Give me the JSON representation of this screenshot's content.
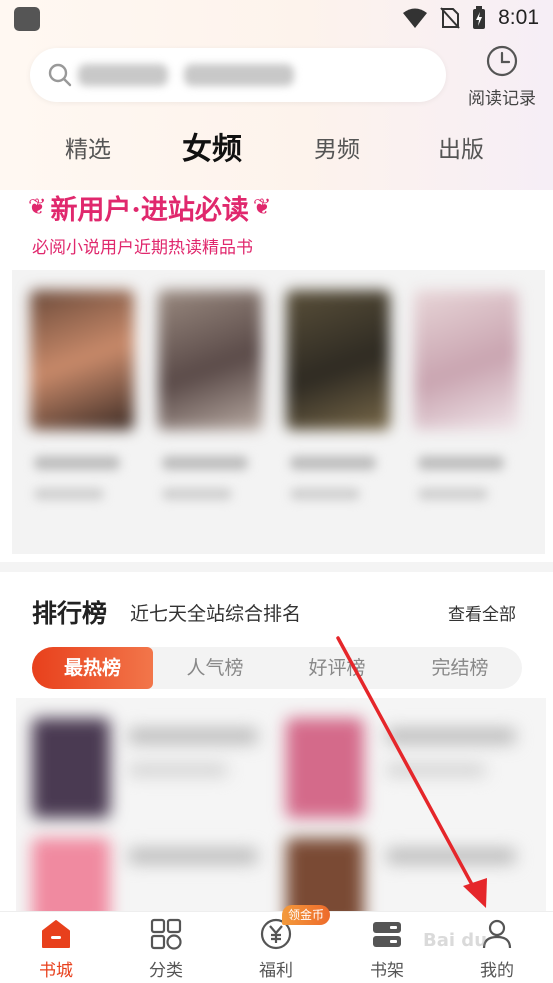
{
  "status_bar": {
    "time": "8:01"
  },
  "header": {
    "history_label": "阅读记录"
  },
  "channel_tabs": [
    {
      "label": "精选"
    },
    {
      "label": "女频"
    },
    {
      "label": "男频"
    },
    {
      "label": "出版"
    }
  ],
  "active_channel": "女频",
  "banner": {
    "title": "新用户·进站必读",
    "subtitle": "必阅小说用户近期热读精品书"
  },
  "ranking": {
    "title": "排行榜",
    "subtitle": "近七天全站综合排名",
    "more_label": "查看全部",
    "tabs": [
      {
        "label": "最热榜"
      },
      {
        "label": "人气榜"
      },
      {
        "label": "好评榜"
      },
      {
        "label": "完结榜"
      }
    ]
  },
  "bottom_nav": {
    "items": [
      {
        "label": "书城",
        "icon": "home-icon"
      },
      {
        "label": "分类",
        "icon": "category-icon"
      },
      {
        "label": "福利",
        "icon": "coin-icon"
      },
      {
        "label": "书架",
        "icon": "bookshelf-icon"
      },
      {
        "label": "我的",
        "icon": "profile-icon"
      }
    ],
    "coin_badge": "领金币"
  },
  "colors": {
    "accent": "#e8401c",
    "banner_pink": "#e0286d",
    "annotation_arrow": "#e5262a"
  }
}
